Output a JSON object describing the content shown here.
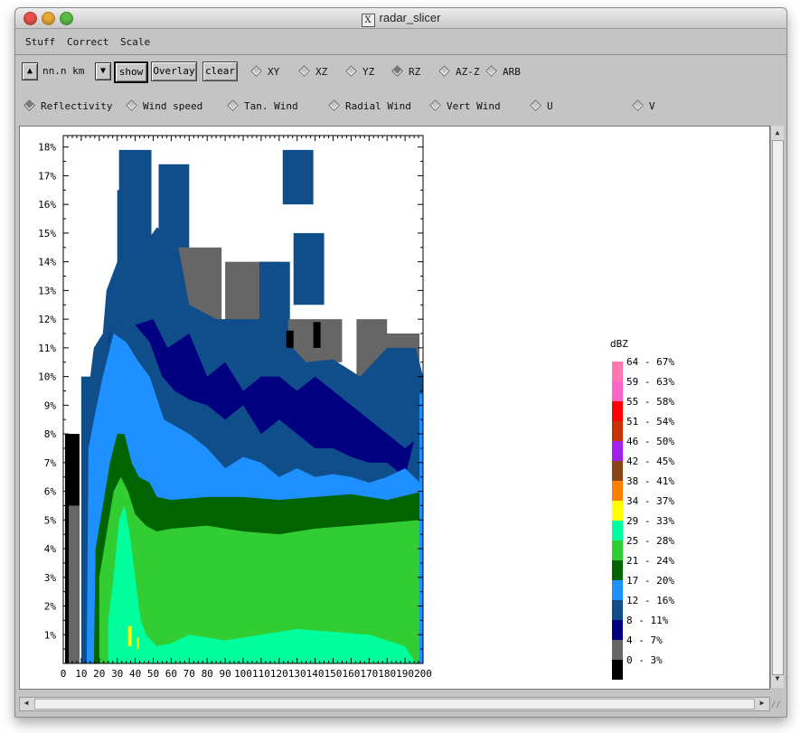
{
  "window": {
    "title": "radar_slicer",
    "icon": "x11-icon"
  },
  "menu": [
    "Stuff",
    "Correct",
    "Scale"
  ],
  "toolbar": {
    "distance_value": "nn.n km",
    "show_label": "show",
    "overlay_label": "Overlay",
    "clear_label": "clear",
    "views": [
      {
        "label": "XY",
        "selected": false
      },
      {
        "label": "XZ",
        "selected": false
      },
      {
        "label": "YZ",
        "selected": false
      },
      {
        "label": "RZ",
        "selected": true
      },
      {
        "label": "AZ-Z",
        "selected": false
      },
      {
        "label": "ARB",
        "selected": false
      }
    ],
    "fields": [
      {
        "label": "Reflectivity",
        "selected": true
      },
      {
        "label": "Wind speed",
        "selected": false
      },
      {
        "label": "Tan. Wind",
        "selected": false
      },
      {
        "label": "Radial Wind",
        "selected": false
      },
      {
        "label": "Vert Wind",
        "selected": false
      },
      {
        "label": "U",
        "selected": false
      },
      {
        "label": "V",
        "selected": false
      }
    ]
  },
  "chart_data": {
    "type": "heatmap",
    "x_ticks": [
      "0",
      "10",
      "20",
      "30",
      "40",
      "50",
      "60",
      "70",
      "80",
      "90",
      "100",
      "110",
      "120",
      "130",
      "140",
      "150",
      "160",
      "170",
      "180",
      "190",
      "200"
    ],
    "y_ticks": [
      "1%",
      "2%",
      "3%",
      "4%",
      "5%",
      "6%",
      "7%",
      "8%",
      "9%",
      "10%",
      "11%",
      "12%",
      "13%",
      "14%",
      "15%",
      "16%",
      "17%",
      "18%"
    ],
    "xlim": [
      0,
      200
    ],
    "ylim": [
      0,
      18.4
    ],
    "legend_title": "dBZ",
    "legend": [
      {
        "label": "64 - 67%",
        "color": "#ff78b4"
      },
      {
        "label": "59 - 63%",
        "color": "#ff64c8"
      },
      {
        "label": "55 - 58%",
        "color": "#ff0000"
      },
      {
        "label": "51 - 54%",
        "color": "#c83200"
      },
      {
        "label": "46 - 50%",
        "color": "#a020f0"
      },
      {
        "label": "42 - 45%",
        "color": "#8b4513"
      },
      {
        "label": "38 - 41%",
        "color": "#ff7f00"
      },
      {
        "label": "34 - 37%",
        "color": "#ffff00"
      },
      {
        "label": "29 - 33%",
        "color": "#00ff9c"
      },
      {
        "label": "25 - 28%",
        "color": "#32cd32"
      },
      {
        "label": "21 - 24%",
        "color": "#006400"
      },
      {
        "label": "17 - 20%",
        "color": "#1e90ff"
      },
      {
        "label": "12 - 16%",
        "color": "#104e8b"
      },
      {
        "label": "8 - 11%",
        "color": "#000080"
      },
      {
        "label": "4 - 7%",
        "color": "#666666"
      },
      {
        "label": "0 - 3%",
        "color": "#000000"
      }
    ]
  }
}
